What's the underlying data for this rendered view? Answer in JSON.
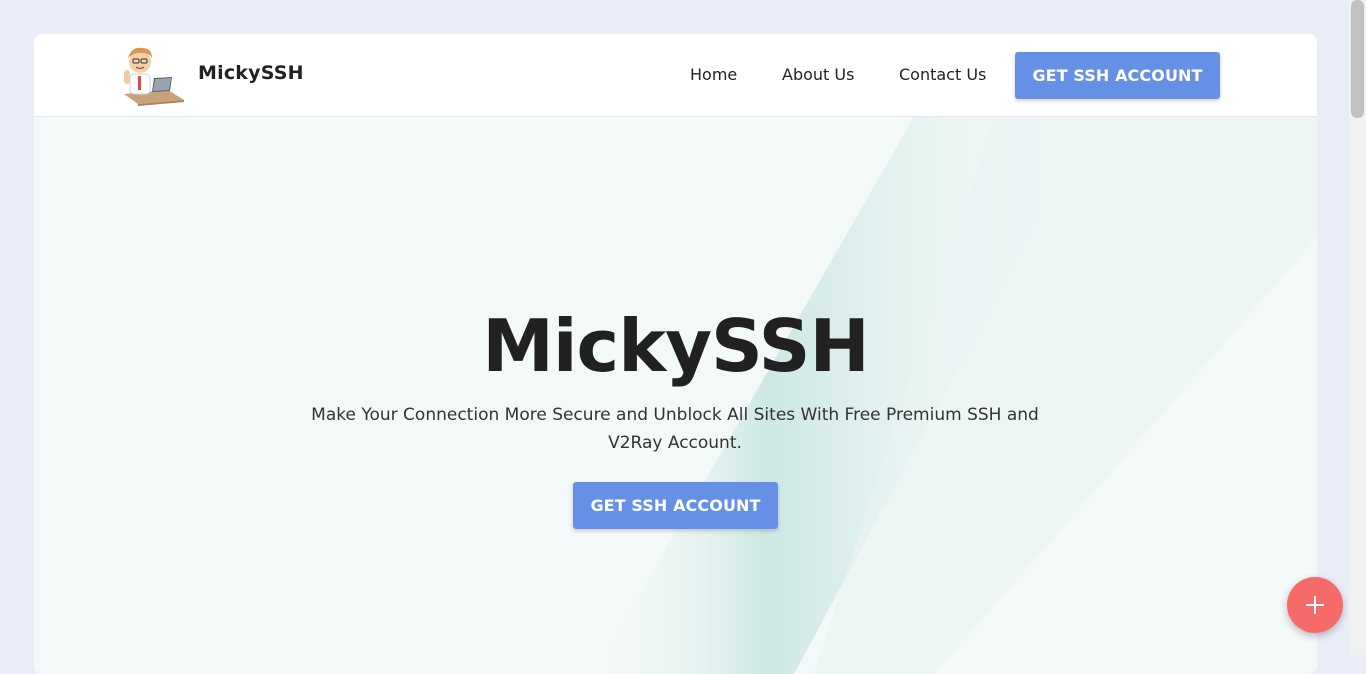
{
  "navbar": {
    "brand": "MickySSH",
    "logo_icon": "cartoon-man-laptop-logo",
    "links": [
      "Home",
      "About Us",
      "Contact Us"
    ],
    "cta_label": "GET SSH ACCOUNT"
  },
  "hero": {
    "title": "MickySSH",
    "subtitle": "Make Your Connection More Secure and Unblock All Sites With Free Premium SSH and V2Ray Account.",
    "cta_label": "GET SSH ACCOUNT"
  },
  "fab": {
    "icon": "plus-icon"
  },
  "colors": {
    "accent": "#6690e6",
    "fab": "#f76a6a",
    "page_bg": "#e9edf8",
    "hero_bg": "#f3f8f8",
    "hero_stripe": "#c9e6e2"
  }
}
